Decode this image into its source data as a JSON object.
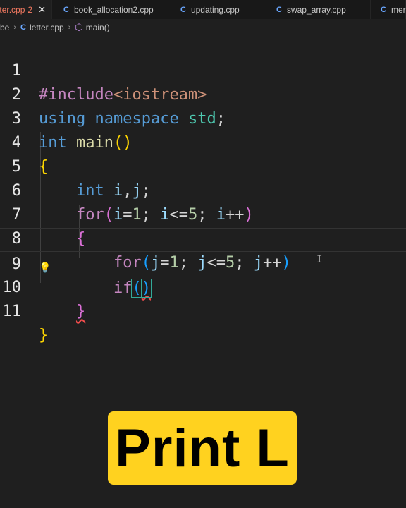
{
  "tabs": [
    {
      "label": "ter.cpp",
      "dirty_count": "2",
      "close": "✕",
      "active": true
    },
    {
      "label": "book_allocation2.cpp",
      "icon": "C"
    },
    {
      "label": "updating.cpp",
      "icon": "C"
    },
    {
      "label": "swap_array.cpp",
      "icon": "C"
    },
    {
      "label": "merg",
      "icon": "C"
    }
  ],
  "breadcrumb": {
    "root": "be",
    "file": "letter.cpp",
    "symbol": "main()",
    "sep": "›",
    "file_icon": "C",
    "symbol_icon": "cube-icon"
  },
  "editor": {
    "line_numbers": [
      "1",
      "2",
      "3",
      "4",
      "5",
      "6",
      "7",
      "8",
      "9",
      "10",
      "11"
    ],
    "lines": [
      "#include<iostream>",
      "using namespace std;",
      "int main()",
      "{",
      "int i,j;",
      "for(i=1; i<=5; i++)",
      "{",
      "for(j=1; j<=5; j++)",
      "if()",
      "}",
      "}"
    ],
    "current_line": 9,
    "lightbulb_icon": "lightbulb-icon"
  },
  "banner": {
    "text": "Print L",
    "color": "#ffd21f"
  }
}
